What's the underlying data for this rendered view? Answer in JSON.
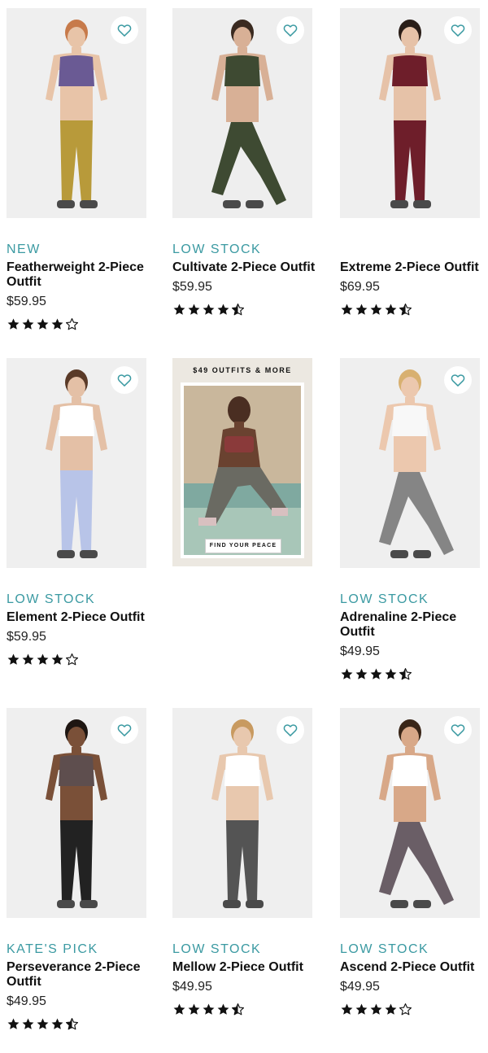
{
  "products": [
    {
      "badge": "NEW",
      "name": "Featherweight 2-Piece Outfit",
      "price": "$59.95",
      "rating": 4,
      "favorite_icon": "heart-outline-icon",
      "colors": {
        "bg": "#efefef",
        "top": "#6a5a94",
        "bottom": "#b89a3a",
        "skin": "#e8c4a8",
        "hair": "#c77a4a"
      }
    },
    {
      "badge": "LOW STOCK",
      "name": "Cultivate 2-Piece Outfit",
      "price": "$59.95",
      "rating": 4.5,
      "favorite_icon": "heart-outline-icon",
      "colors": {
        "bg": "#eeeeee",
        "top": "#3e4a32",
        "bottom": "#3e4a32",
        "skin": "#d8b096",
        "hair": "#3a2a20"
      }
    },
    {
      "badge": "",
      "name": "Extreme 2-Piece Outfit",
      "price": "$69.95",
      "rating": 4.5,
      "favorite_icon": "heart-outline-icon",
      "colors": {
        "bg": "#efefef",
        "top": "#6e1e2a",
        "bottom": "#6e1e2a",
        "skin": "#e6c2a8",
        "hair": "#2a1e18"
      }
    },
    {
      "badge": "LOW STOCK",
      "name": "Element 2-Piece Outfit",
      "price": "$59.95",
      "rating": 4,
      "favorite_icon": "heart-outline-icon",
      "colors": {
        "bg": "#efefef",
        "top": "#ffffff",
        "bottom": "#b8c4e8",
        "skin": "#e4c0a6",
        "hair": "#5a3a28"
      }
    },
    {
      "badge": "LOW STOCK",
      "name": "Adrenaline 2-Piece Outfit",
      "price": "$49.95",
      "rating": 4.5,
      "favorite_icon": "heart-outline-icon",
      "colors": {
        "bg": "#efefef",
        "top": "#f8f8f8",
        "bottom": "#858585",
        "skin": "#ecc8ae",
        "hair": "#d8b070"
      }
    },
    {
      "badge": "KATE'S PICK",
      "name": "Perseverance 2-Piece Outfit",
      "price": "$49.95",
      "rating": 4.5,
      "favorite_icon": "heart-outline-icon",
      "colors": {
        "bg": "#efefef",
        "top": "#5e4e4e",
        "bottom": "#222222",
        "skin": "#7a5038",
        "hair": "#1e1612"
      }
    },
    {
      "badge": "LOW STOCK",
      "name": "Mellow 2-Piece Outfit",
      "price": "$49.95",
      "rating": 4.5,
      "favorite_icon": "heart-outline-icon",
      "colors": {
        "bg": "#efefef",
        "top": "#ffffff",
        "bottom": "#545454",
        "skin": "#e8c8ae",
        "hair": "#c89a60"
      }
    },
    {
      "badge": "LOW STOCK",
      "name": "Ascend 2-Piece Outfit",
      "price": "$49.95",
      "rating": 4,
      "favorite_icon": "heart-outline-icon",
      "colors": {
        "bg": "#efefef",
        "top": "#ffffff",
        "bottom": "#6a5e66",
        "skin": "#d8a888",
        "hair": "#3a2618"
      }
    }
  ],
  "promo": {
    "headline": "$49 OUTFITS & MORE",
    "cta": "FIND YOUR PEACE",
    "colors": {
      "bg": "#ece8e1",
      "top": "#8a3a3a",
      "bottom": "#6a6a62",
      "skin": "#6a4230"
    }
  },
  "colors": {
    "accent": "#3b9aa2",
    "text": "#111111",
    "star": "#111111"
  }
}
